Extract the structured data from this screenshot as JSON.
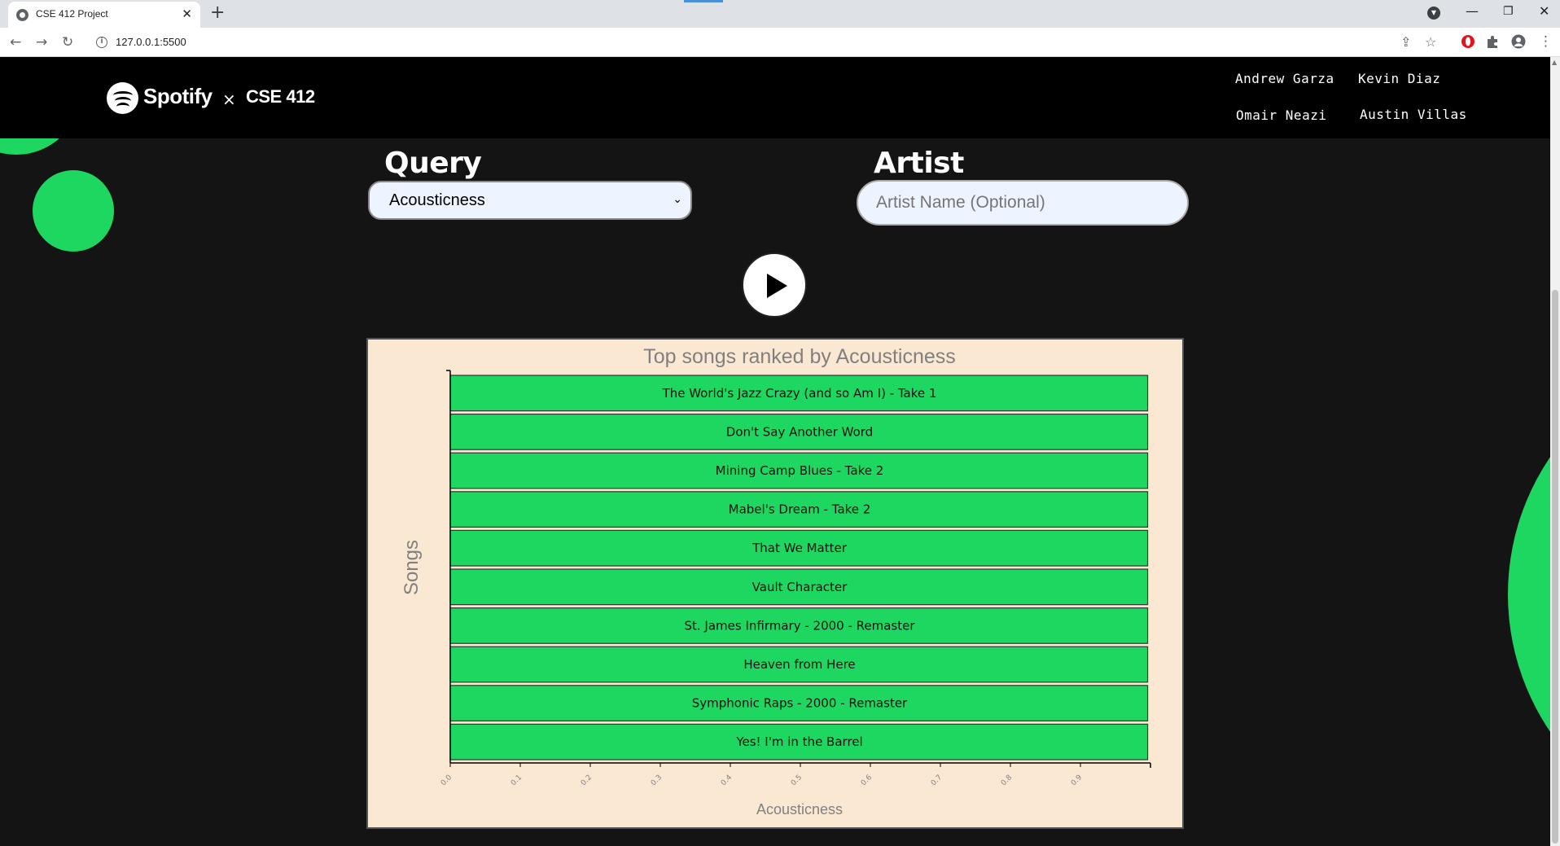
{
  "browser": {
    "tab_title": "CSE 412 Project",
    "url": "127.0.0.1:5500"
  },
  "header": {
    "logo_text": "Spotify",
    "separator": "×",
    "course": "CSE 412",
    "members": [
      "Andrew Garza",
      "Kevin Diaz",
      "Omair Neazi",
      "Austin Villas"
    ]
  },
  "form": {
    "query_label": "Query",
    "query_selected": "Acousticness",
    "artist_label": "Artist",
    "artist_placeholder": "Artist Name (Optional)",
    "artist_value": ""
  },
  "colors": {
    "accent": "#1ed760",
    "chart_bg": "#fbe8d3",
    "header_bg": "#000000",
    "page_bg": "#141414"
  },
  "chart_data": {
    "type": "bar",
    "orientation": "horizontal",
    "title": "Top songs ranked by Acousticness",
    "xlabel": "Acousticness",
    "ylabel": "Songs",
    "xlim": [
      0,
      1
    ],
    "xticks": [
      "0.0",
      "0.1",
      "0.2",
      "0.3",
      "0.4",
      "0.5",
      "0.6",
      "0.7",
      "0.8",
      "0.9"
    ],
    "categories": [
      "The World's Jazz Crazy (and so Am I) - Take 1",
      "Don't Say Another Word",
      "Mining Camp Blues - Take 2",
      "Mabel's Dream - Take 2",
      "That We Matter",
      "Vault Character",
      "St. James Infirmary - 2000 - Remaster",
      "Heaven from Here",
      "Symphonic Raps - 2000 - Remaster",
      "Yes! I'm in the Barrel"
    ],
    "values": [
      0.996,
      0.996,
      0.996,
      0.996,
      0.996,
      0.996,
      0.996,
      0.996,
      0.996,
      0.996
    ],
    "bar_color": "#1ed760",
    "grid": false
  }
}
